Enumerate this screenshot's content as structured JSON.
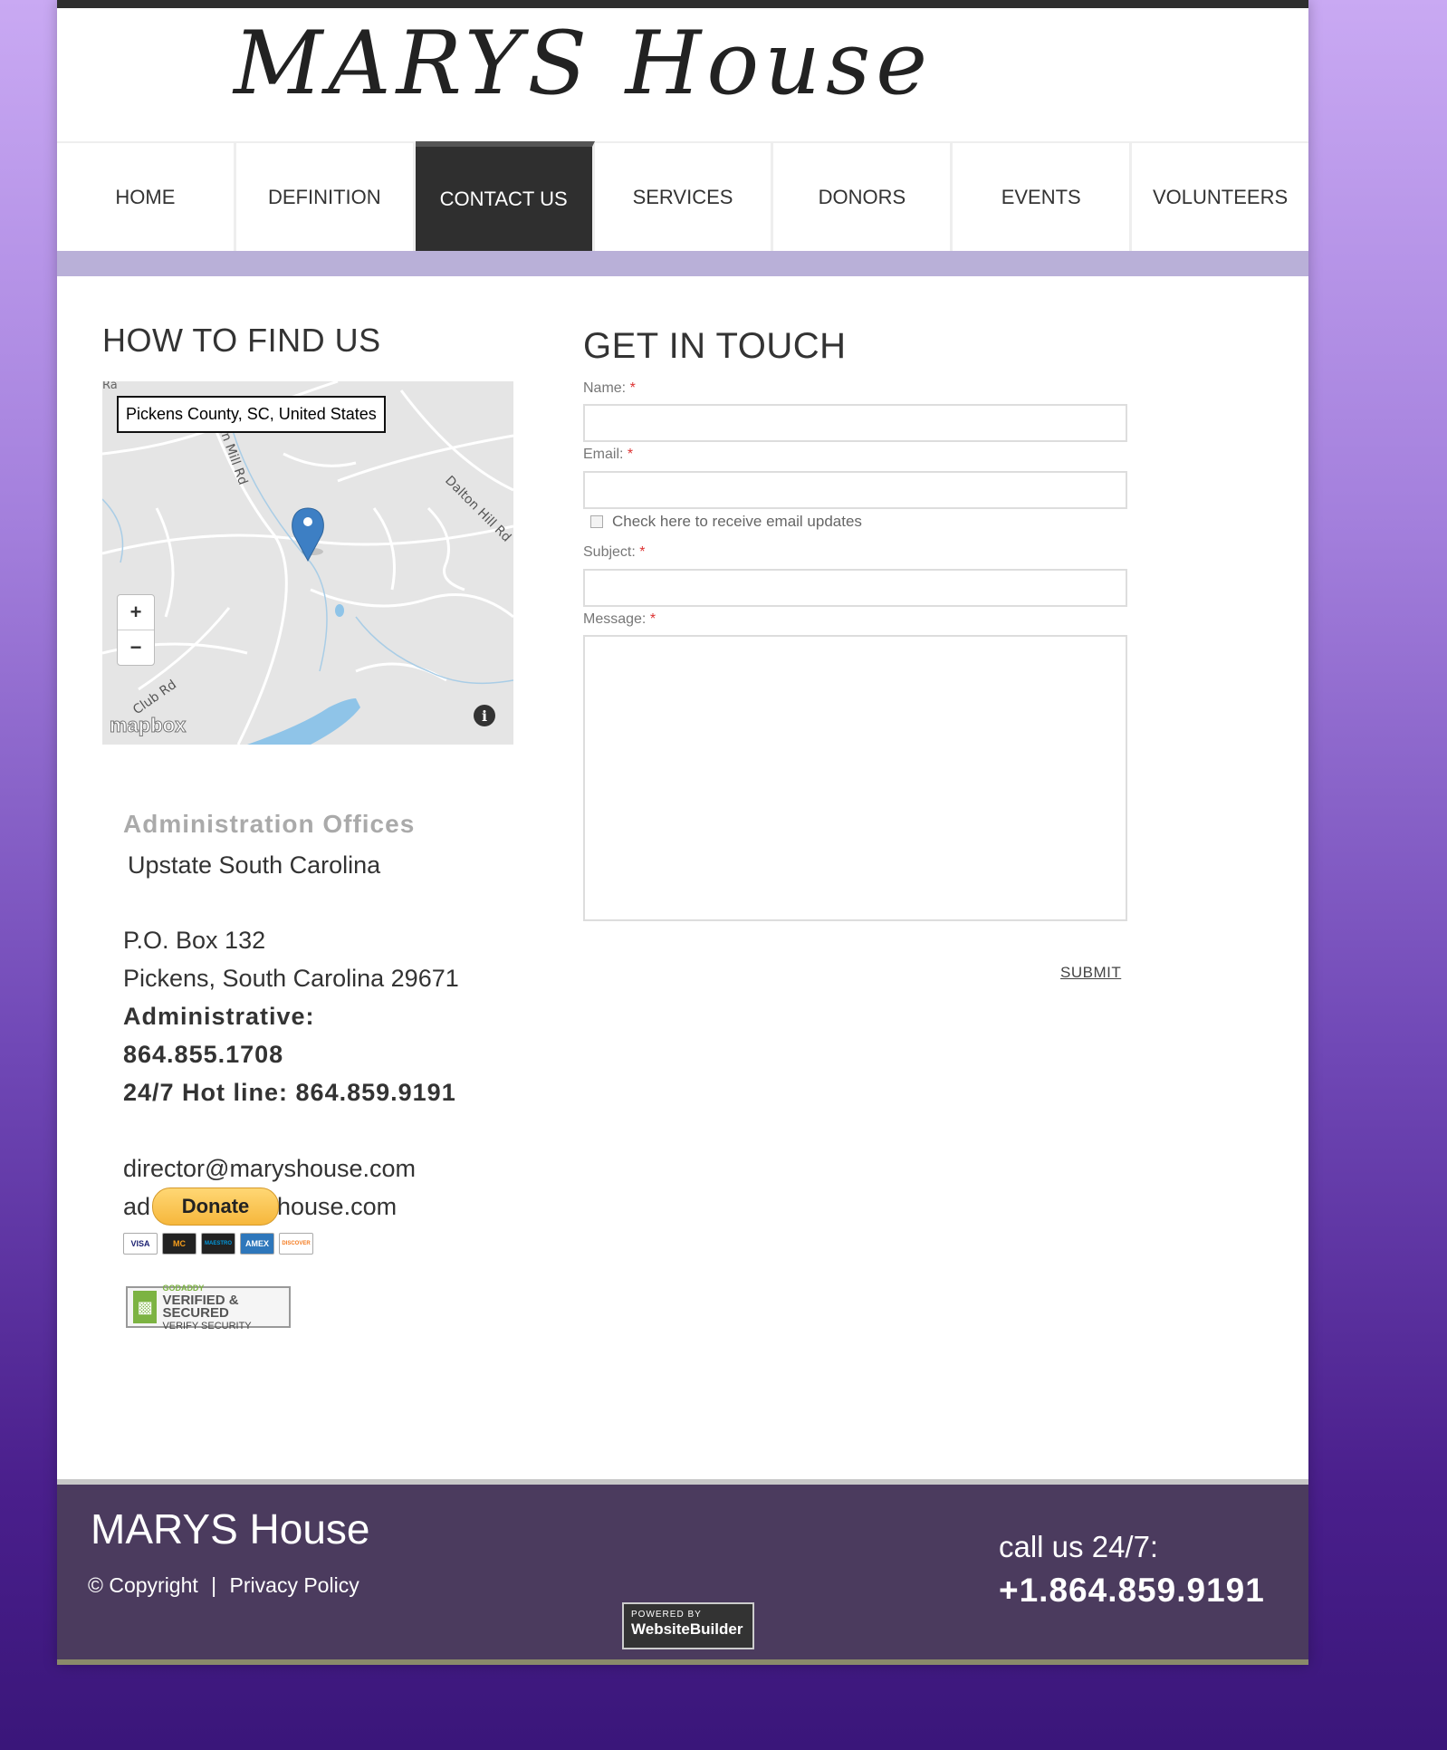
{
  "site": {
    "logo": "MARYS House"
  },
  "nav": {
    "items": [
      {
        "label": "HOME"
      },
      {
        "label": "DEFINITION"
      },
      {
        "label": "CONTACT US",
        "active": true
      },
      {
        "label": "SERVICES"
      },
      {
        "label": "DONORS"
      },
      {
        "label": "EVENTS"
      },
      {
        "label": "VOLUNTEERS"
      }
    ]
  },
  "find": {
    "title": "HOW TO FIND US",
    "map": {
      "location": "Pickens County, SC, United States",
      "zoom_in": "+",
      "zoom_out": "−",
      "attribution": "mapbox",
      "info": "i",
      "road_labels": [
        "Ra",
        "in Mill Rd",
        "Dalton Hill Rd",
        "Club Rd"
      ]
    },
    "admin_title": "Administration Offices",
    "region": "Upstate South Carolina",
    "po_box": "P.O. Box 132",
    "city": "Pickens, South Carolina 29671",
    "admin_label": "Administrative:",
    "admin_phone": "864.855.1708",
    "hotline": "24/7 Hot line: 864.859.9191",
    "email1": "director@maryshouse.com",
    "email2_prefix": "ad",
    "email2_suffix": "house.com",
    "donate_label": "Donate",
    "cards": [
      "VISA",
      "MC",
      "MAESTRO",
      "AMEX",
      "DISCOVER"
    ],
    "godaddy": {
      "brand": "GODADDY",
      "line": "VERIFIED & SECURED",
      "sub": "VERIFY SECURITY"
    }
  },
  "form": {
    "title": "GET IN TOUCH",
    "name_label": "Name:",
    "email_label": "Email:",
    "checkbox_label": "Check here to receive email updates",
    "subject_label": "Subject:",
    "message_label": "Message:",
    "required_mark": "*",
    "submit_label": "SUBMIT"
  },
  "footer": {
    "brand": "MARYS House",
    "copyright": "© Copyright",
    "separator": "|",
    "privacy": "Privacy Policy",
    "call_label": "call us 24/7:",
    "phone": "+1.864.859.9191",
    "powered_small": "POWERED BY",
    "powered_big": "WebsiteBuilder"
  },
  "colors": {
    "nav_active_bg": "#2f2f2f",
    "accent_band": "#b9b0d8",
    "footer_bg": "#4b3b5e",
    "required": "#dd3333",
    "donate": "#f6b73c"
  }
}
